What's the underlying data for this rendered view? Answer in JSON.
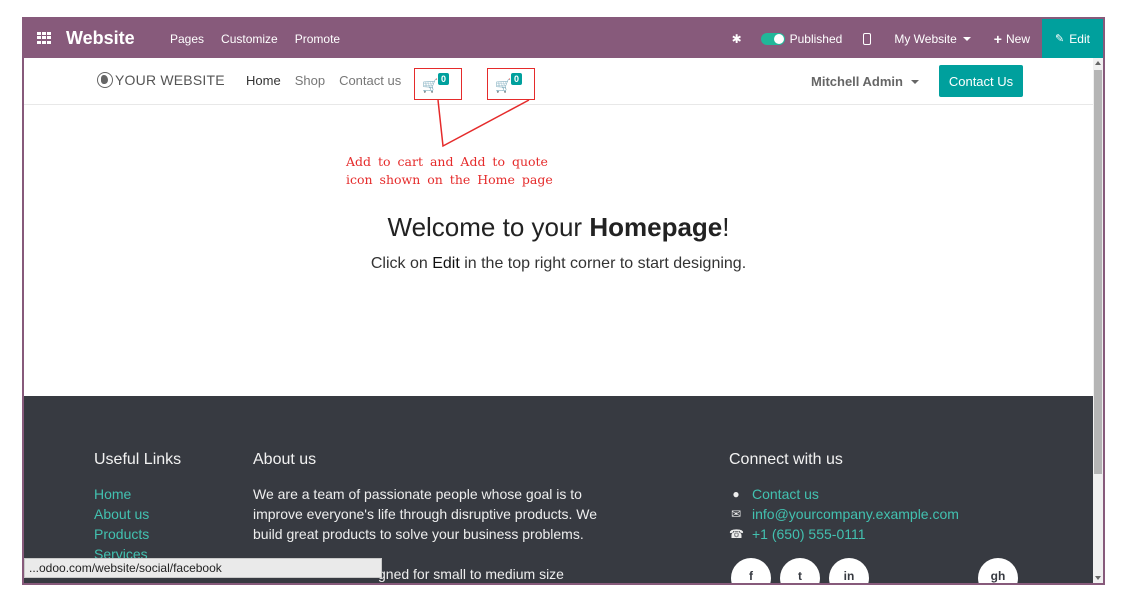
{
  "admin_bar": {
    "brand": "Website",
    "menu": [
      "Pages",
      "Customize",
      "Promote"
    ],
    "published_label": "Published",
    "website_selector": "My Website",
    "new_label": "New",
    "edit_label": "Edit"
  },
  "site_header": {
    "logo_text": "YOUR WEBSITE",
    "nav": [
      "Home",
      "Shop",
      "Contact us"
    ],
    "active_nav": "Home",
    "cart_count": "0",
    "quote_count": "0",
    "user_name": "Mitchell Admin",
    "contact_button": "Contact Us"
  },
  "annotation": {
    "line1": "Add to cart and Add to quote",
    "line2": "icon shown on the Home page"
  },
  "hero": {
    "title_prefix": "Welcome to your ",
    "title_bold": "Homepage",
    "title_suffix": "!",
    "sub_prefix": "Click on ",
    "sub_bold": "Edit",
    "sub_suffix": " in the top right corner to start designing."
  },
  "footer": {
    "useful_links_heading": "Useful Links",
    "useful_links": [
      "Home",
      "About us",
      "Products",
      "Services"
    ],
    "about_heading": "About us",
    "about_text": "We are a team of passionate people whose goal is to improve everyone's life through disruptive products. We build great products to solve your business problems.",
    "about_text_2": "gned for small to medium size",
    "connect_heading": "Connect with us",
    "connect_items": [
      {
        "icon": "comment-icon",
        "text": "Contact us"
      },
      {
        "icon": "envelope-icon",
        "text": "info@yourcompany.example.com"
      },
      {
        "icon": "phone-icon",
        "text": "+1 (650) 555-0111"
      }
    ],
    "social": [
      "f",
      "t",
      "in",
      "gh"
    ]
  },
  "status_bar": {
    "url": "...odoo.com/website/social/facebook"
  },
  "colors": {
    "admin_purple": "#875a7b",
    "accent_teal": "#00a09d",
    "annotation_red": "#e52b2b",
    "footer_bg": "#373a41",
    "footer_link": "#42c1b0"
  }
}
